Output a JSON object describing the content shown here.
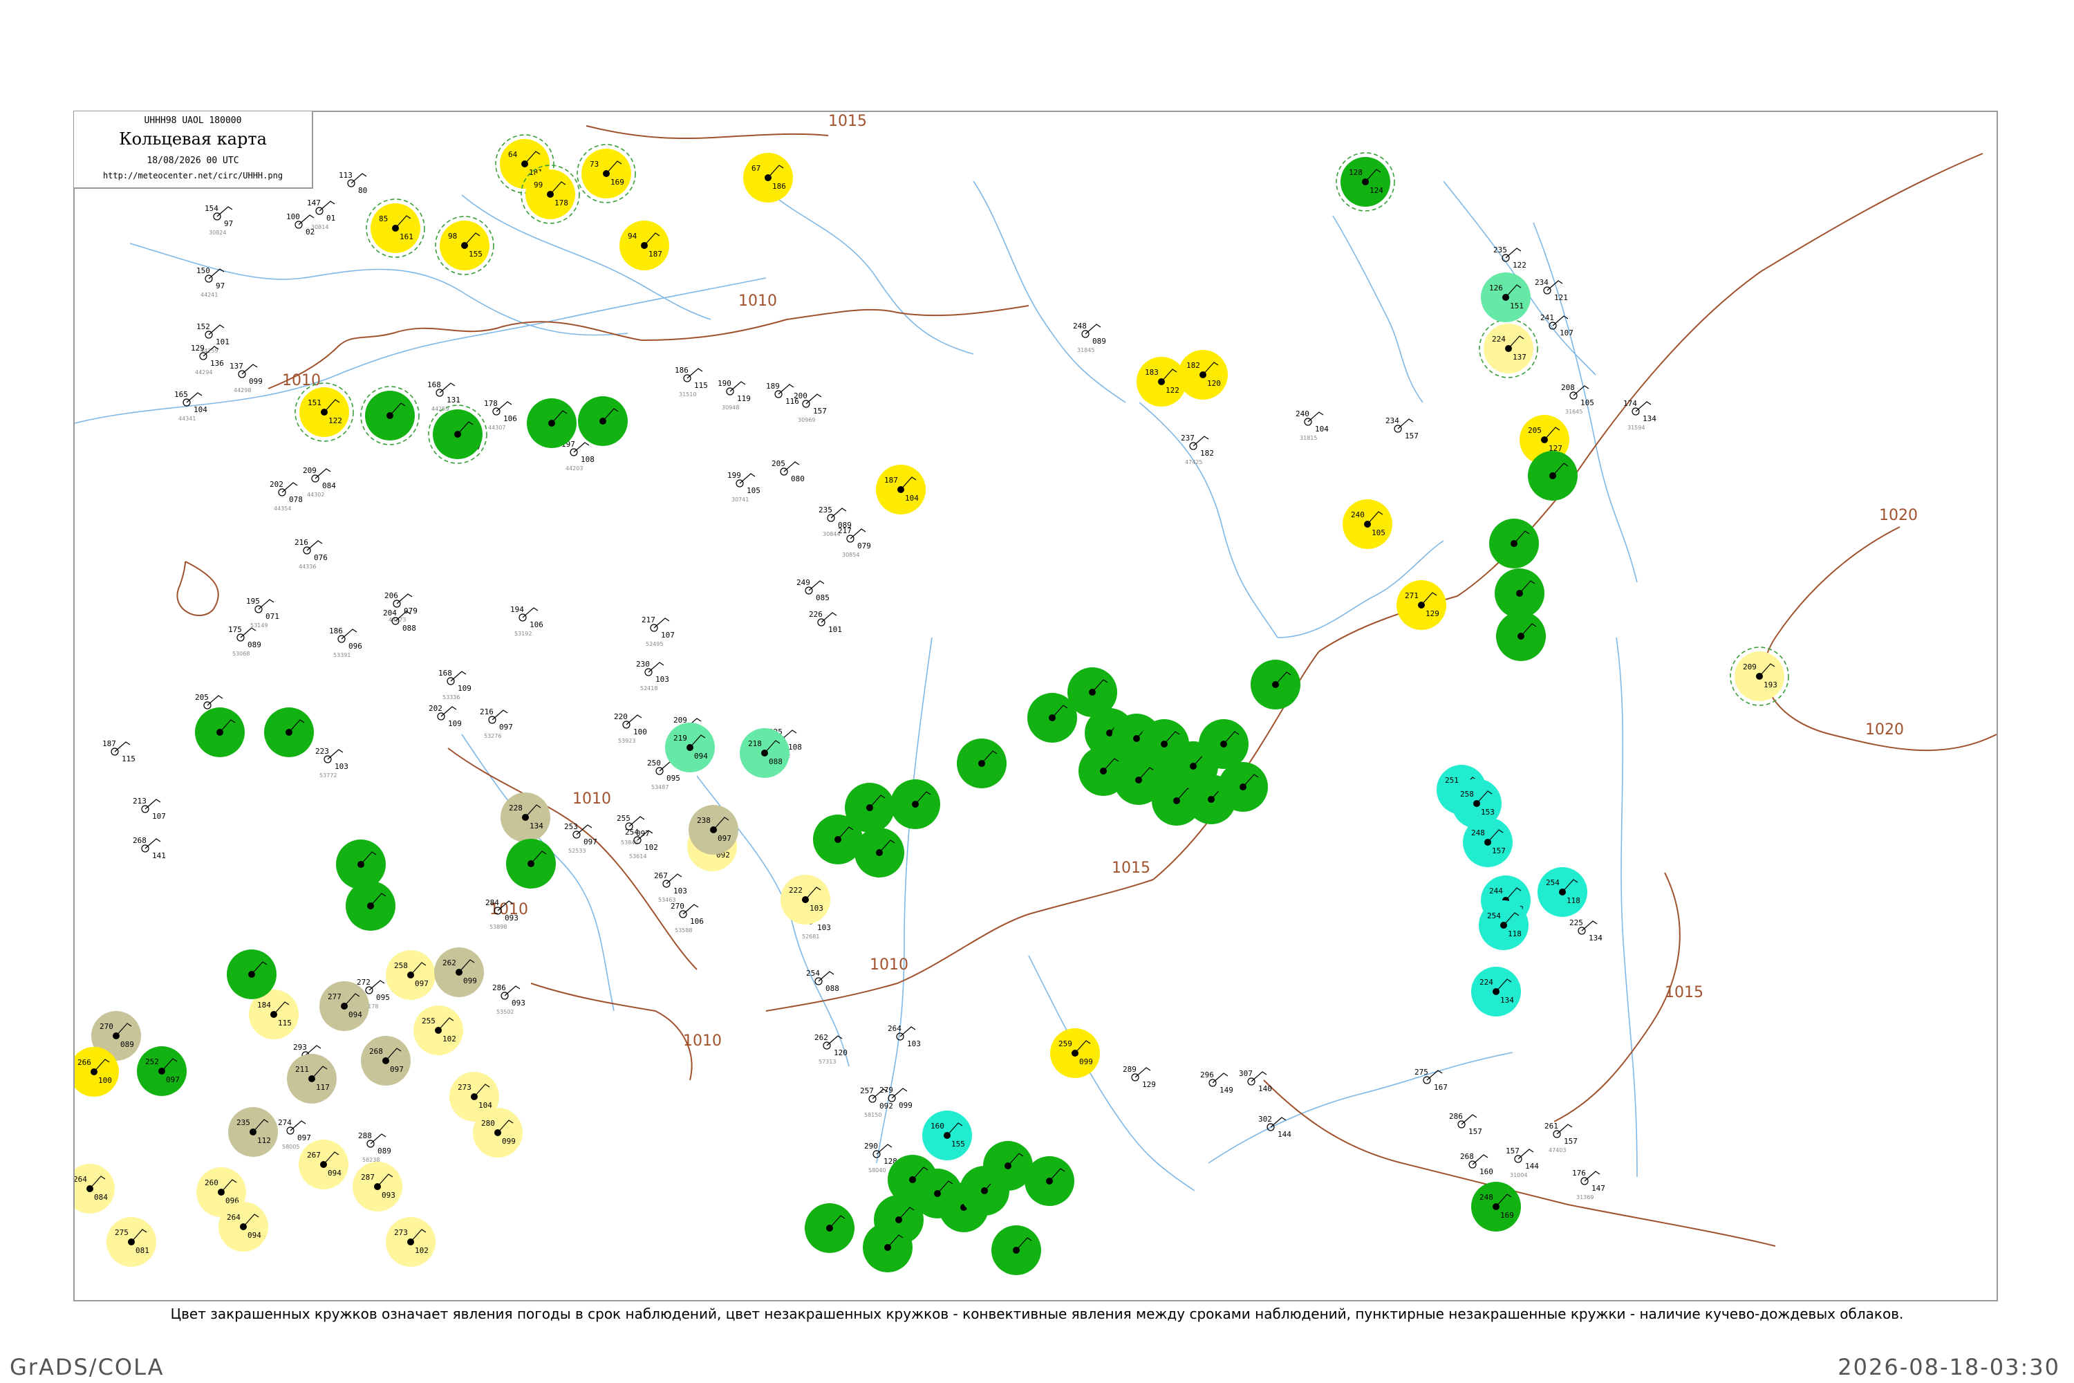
{
  "header": {
    "code": "UHHH98  UAOL  180000",
    "title": "Кольцевая карта",
    "datetime": "18/08/2026 00 UTC",
    "url": "http://meteocenter.net/circ/UHHH.png"
  },
  "caption": "Цвет закрашенных кружков означает явления погоды в срок наблюдений, цвет незакрашенных кружков - конвективные явления между сроками наблюдений, пунктирные незакрашенные кружки - наличие кучево-дождевых облаков.",
  "footer": {
    "left": "GrADS/COLA",
    "right": "2026-08-18-03:30"
  },
  "isobars": [
    {
      "label": "1015"
    },
    {
      "label": "1010"
    },
    {
      "label": "1010"
    },
    {
      "label": "1010"
    },
    {
      "label": "1010"
    },
    {
      "label": "1010"
    },
    {
      "label": "1010"
    },
    {
      "label": "1015"
    },
    {
      "label": "1015"
    },
    {
      "label": "1020"
    },
    {
      "label": "1020"
    }
  ],
  "colors": {
    "rain": "#13b213",
    "fog": "#ffeb00",
    "haze": "#fff59a",
    "dust": "#c8c49a",
    "shower": "#22ecd0",
    "light_shower": "#66e8a6",
    "isobar": "#a0522d",
    "river": "#7fb8e6",
    "cb_ring": "#3a9e3a"
  },
  "stations": [
    {
      "t": "113",
      "p": "80",
      "id": ""
    },
    {
      "t": "154",
      "p": "97",
      "id": "30824"
    },
    {
      "t": "147",
      "p": "01",
      "id": "30814"
    },
    {
      "t": "100",
      "p": "02",
      "id": ""
    },
    {
      "t": "150",
      "p": "97",
      "id": "44241"
    },
    {
      "t": "152",
      "p": "101",
      "id": "44259"
    },
    {
      "t": "129",
      "p": "136",
      "id": "44294"
    },
    {
      "t": "137",
      "p": "099",
      "id": "44298"
    },
    {
      "t": "165",
      "p": "104",
      "id": "44341"
    },
    {
      "t": "202",
      "p": "078",
      "id": "44354"
    },
    {
      "t": "216",
      "p": "076",
      "id": "44336"
    },
    {
      "t": "195",
      "p": "071",
      "id": "53149"
    },
    {
      "t": "175",
      "p": "089",
      "id": "53068"
    },
    {
      "t": "205",
      "p": "104",
      "id": "53564"
    },
    {
      "t": "187",
      "p": "115",
      "id": ""
    },
    {
      "t": "213",
      "p": "107",
      "id": ""
    },
    {
      "t": "268",
      "p": "141",
      "id": ""
    },
    {
      "t": "223",
      "p": "103",
      "id": "53772"
    },
    {
      "t": "186",
      "p": "096",
      "id": "53391"
    },
    {
      "t": "168",
      "p": "109",
      "id": "53336"
    },
    {
      "t": "202",
      "p": "109",
      "id": ""
    },
    {
      "t": "216",
      "p": "097",
      "id": "53276"
    },
    {
      "t": "206",
      "p": "079",
      "id": "44373"
    },
    {
      "t": "204",
      "p": "088",
      "id": ""
    },
    {
      "t": "194",
      "p": "106",
      "id": "53192"
    },
    {
      "t": "178",
      "p": "106",
      "id": "44307"
    },
    {
      "t": "209",
      "p": "084",
      "id": "44302"
    },
    {
      "t": "168",
      "p": "131",
      "id": "44259"
    },
    {
      "t": "202",
      "p": "097",
      "id": ""
    },
    {
      "t": "197",
      "p": "108",
      "id": "44203"
    },
    {
      "t": "186",
      "p": "115",
      "id": "31510"
    },
    {
      "t": "190",
      "p": "119",
      "id": "30948"
    },
    {
      "t": "189",
      "p": "116",
      "id": ""
    },
    {
      "t": "200",
      "p": "157",
      "id": "30969"
    },
    {
      "t": "199",
      "p": "105",
      "id": "30741"
    },
    {
      "t": "205",
      "p": "080",
      "id": ""
    },
    {
      "t": "235",
      "p": "089",
      "id": "30844"
    },
    {
      "t": "217",
      "p": "079",
      "id": "30854"
    },
    {
      "t": "249",
      "p": "085",
      "id": ""
    },
    {
      "t": "226",
      "p": "101",
      "id": ""
    },
    {
      "t": "217",
      "p": "107",
      "id": "52495"
    },
    {
      "t": "230",
      "p": "103",
      "id": "52418"
    },
    {
      "t": "220",
      "p": "100",
      "id": "53923"
    },
    {
      "t": "209",
      "p": "101",
      "id": ""
    },
    {
      "t": "250",
      "p": "095",
      "id": "53487"
    },
    {
      "t": "255",
      "p": "097",
      "id": "53845"
    },
    {
      "t": "225",
      "p": "108",
      "id": "53772"
    },
    {
      "t": "254",
      "p": "102",
      "id": "53614"
    },
    {
      "t": "253",
      "p": "097",
      "id": "52533"
    },
    {
      "t": "267",
      "p": "103",
      "id": "53463"
    },
    {
      "t": "270",
      "p": "106",
      "id": "53588"
    },
    {
      "t": "284",
      "p": "093",
      "id": "53898"
    },
    {
      "t": "272",
      "p": "095",
      "id": "57178"
    },
    {
      "t": "286",
      "p": "093",
      "id": "53502"
    },
    {
      "t": "274",
      "p": "097",
      "id": "58005"
    },
    {
      "t": "288",
      "p": "089",
      "id": "58238"
    },
    {
      "t": "293",
      "p": "103",
      "id": "57231"
    },
    {
      "t": "230",
      "p": "103",
      "id": "52681"
    },
    {
      "t": "254",
      "p": "088",
      "id": ""
    },
    {
      "t": "262",
      "p": "120",
      "id": "57313"
    },
    {
      "t": "264",
      "p": "103",
      "id": ""
    },
    {
      "t": "279",
      "p": "099",
      "id": ""
    },
    {
      "t": "257",
      "p": "092",
      "id": "58150"
    },
    {
      "t": "290",
      "p": "128",
      "id": "58040"
    },
    {
      "t": "289",
      "p": "129",
      "id": ""
    },
    {
      "t": "296",
      "p": "149",
      "id": ""
    },
    {
      "t": "307",
      "p": "140",
      "id": ""
    },
    {
      "t": "302",
      "p": "144",
      "id": ""
    },
    {
      "t": "275",
      "p": "167",
      "id": ""
    },
    {
      "t": "286",
      "p": "157",
      "id": ""
    },
    {
      "t": "268",
      "p": "160",
      "id": ""
    },
    {
      "t": "261",
      "p": "157",
      "id": "47403"
    },
    {
      "t": "157",
      "p": "144",
      "id": "31004"
    },
    {
      "t": "176",
      "p": "147",
      "id": "31369"
    },
    {
      "t": "225",
      "p": "134",
      "id": ""
    },
    {
      "t": "235",
      "p": "122",
      "id": ""
    },
    {
      "t": "234",
      "p": "121",
      "id": ""
    },
    {
      "t": "241",
      "p": "107",
      "id": ""
    },
    {
      "t": "208",
      "p": "105",
      "id": "31645"
    },
    {
      "t": "174",
      "p": "134",
      "id": "31594"
    },
    {
      "t": "234",
      "p": "157",
      "id": ""
    },
    {
      "t": "237",
      "p": "182",
      "id": "47425"
    },
    {
      "t": "240",
      "p": "104",
      "id": "31815"
    },
    {
      "t": "248",
      "p": "089",
      "id": "31845"
    }
  ],
  "symbols": [
    {
      "t": "64",
      "p": "181",
      "id": ""
    },
    {
      "t": "73",
      "p": "169",
      "id": ""
    },
    {
      "t": "99",
      "p": "178",
      "id": ""
    },
    {
      "t": "85",
      "p": "161",
      "id": ""
    },
    {
      "t": "98",
      "p": "155",
      "id": ""
    },
    {
      "t": "151",
      "p": "122",
      "id": ""
    },
    {
      "t": "94",
      "p": "187",
      "id": ""
    },
    {
      "t": "67",
      "p": "186",
      "id": ""
    },
    {
      "t": "183",
      "p": "122",
      "id": ""
    },
    {
      "t": "182",
      "p": "120",
      "id": ""
    },
    {
      "t": "187",
      "p": "104",
      "id": ""
    },
    {
      "t": "205",
      "p": "127",
      "id": ""
    },
    {
      "t": "224",
      "p": "137",
      "id": ""
    },
    {
      "t": "240",
      "p": "105",
      "id": ""
    },
    {
      "t": "271",
      "p": "129",
      "id": ""
    },
    {
      "t": "209",
      "p": "193",
      "id": ""
    },
    {
      "t": "259",
      "p": "099",
      "id": ""
    },
    {
      "t": "340",
      "p": "092",
      "id": ""
    },
    {
      "t": "222",
      "p": "103",
      "id": ""
    },
    {
      "t": "184",
      "p": "115",
      "id": ""
    },
    {
      "t": "258",
      "p": "097",
      "id": ""
    },
    {
      "t": "255",
      "p": "102",
      "id": ""
    },
    {
      "t": "273",
      "p": "104",
      "id": ""
    },
    {
      "t": "280",
      "p": "099",
      "id": ""
    },
    {
      "t": "273",
      "p": "102",
      "id": ""
    },
    {
      "t": "287",
      "p": "093",
      "id": ""
    },
    {
      "t": "275",
      "p": "081",
      "id": ""
    },
    {
      "t": "264",
      "p": "084",
      "id": ""
    },
    {
      "t": "267",
      "p": "094",
      "id": ""
    },
    {
      "t": "260",
      "p": "096",
      "id": ""
    },
    {
      "t": "264",
      "p": "094",
      "id": ""
    },
    {
      "t": "270",
      "p": "089",
      "id": ""
    },
    {
      "t": "235",
      "p": "112",
      "id": ""
    },
    {
      "t": "277",
      "p": "094",
      "id": ""
    },
    {
      "t": "266",
      "p": "100",
      "id": ""
    },
    {
      "t": "211",
      "p": "117",
      "id": ""
    },
    {
      "t": "268",
      "p": "097",
      "id": ""
    },
    {
      "t": "262",
      "p": "099",
      "id": ""
    },
    {
      "t": "238",
      "p": "097",
      "id": ""
    },
    {
      "t": "228",
      "p": "134",
      "id": ""
    },
    {
      "t": "252",
      "p": "097",
      "id": ""
    },
    {
      "t": "128",
      "p": "124",
      "id": ""
    },
    {
      "t": "126",
      "p": "151",
      "id": ""
    },
    {
      "t": "218",
      "p": "088",
      "id": ""
    },
    {
      "t": "219",
      "p": "094",
      "id": ""
    },
    {
      "t": "251",
      "p": "152",
      "id": ""
    },
    {
      "t": "258",
      "p": "153",
      "id": ""
    },
    {
      "t": "248",
      "p": "157",
      "id": ""
    },
    {
      "t": "244",
      "p": "168",
      "id": ""
    },
    {
      "t": "160",
      "p": "155",
      "id": ""
    },
    {
      "t": "254",
      "p": "118",
      "id": ""
    },
    {
      "t": "224",
      "p": "134",
      "id": ""
    },
    {
      "t": "254",
      "p": "118",
      "id": ""
    },
    {
      "t": "248",
      "p": "169",
      "id": ""
    }
  ]
}
